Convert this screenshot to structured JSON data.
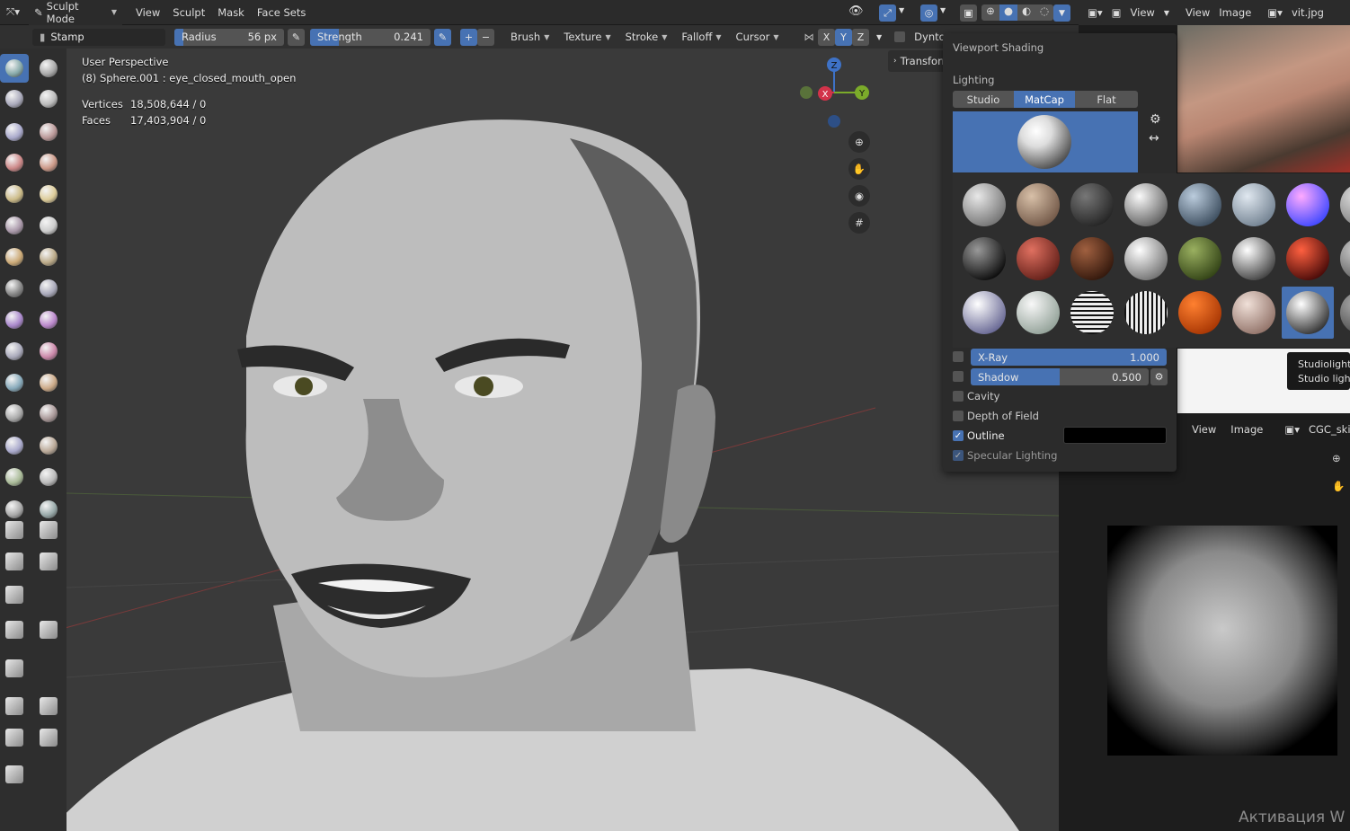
{
  "header": {
    "mode": "Sculpt Mode",
    "menus": [
      "View",
      "Sculpt",
      "Mask",
      "Face Sets"
    ]
  },
  "toolsettings": {
    "brush_name": "Stamp",
    "radius_label": "Radius",
    "radius_value": "56 px",
    "strength_label": "Strength",
    "strength_value": "0.241",
    "strength_fraction": 0.241,
    "menus": [
      "Brush",
      "Texture",
      "Stroke",
      "Falloff",
      "Cursor"
    ],
    "axes": [
      "X",
      "Y",
      "Z"
    ],
    "dyntopo": "Dyntopo"
  },
  "viewport": {
    "view_name": "User Perspective",
    "object_name": "(8) Sphere.001 : eye_closed_mouth_open",
    "vertices_label": "Vertices",
    "vertices_value": "18,508,644 / 0",
    "faces_label": "Faces",
    "faces_value": "17,403,904 / 0",
    "sidebar_tab": "Transform",
    "gizmo": {
      "x": "X",
      "y": "Y",
      "z": "Z"
    }
  },
  "shading_popover": {
    "title": "Viewport Shading",
    "lighting_label": "Lighting",
    "lighting_options": [
      "Studio",
      "MatCap",
      "Flat"
    ],
    "lighting_selected": "MatCap",
    "xray_label": "X-Ray",
    "xray_value": "1.000",
    "shadow_label": "Shadow",
    "shadow_value": "0.500",
    "shadow_fraction": 0.5,
    "cavity_label": "Cavity",
    "dof_label": "Depth of Field",
    "outline_label": "Outline",
    "specular_label": "Specular Lighting",
    "outline_color": "#000000",
    "accent": "#4772b3"
  },
  "right_panel": {
    "top_menus": [
      "View",
      "View",
      "Image"
    ],
    "top_image": "vit.jpg",
    "tooltip_line1": "Studiolight",
    "tooltip_line2": "Studio lighti",
    "bottom_menus": [
      "View",
      "Image"
    ],
    "bottom_image": "CGC_skin",
    "watermark": "Активация W"
  }
}
